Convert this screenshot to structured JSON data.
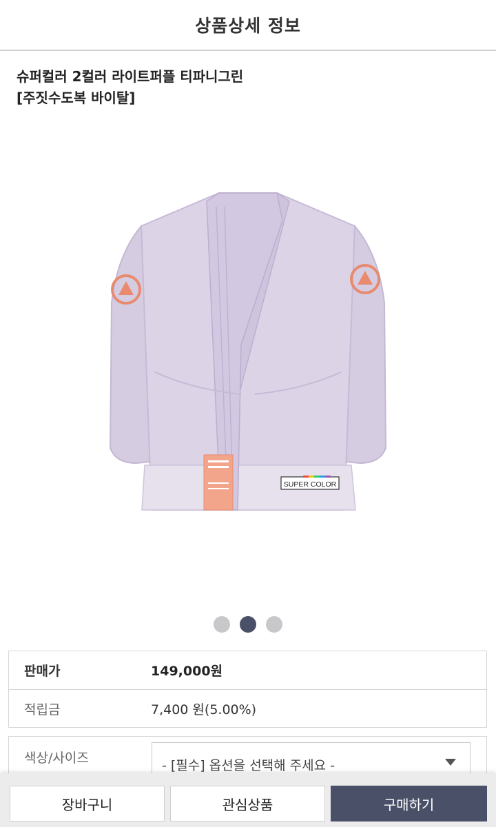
{
  "header": {
    "title": "상품상세 정보"
  },
  "product": {
    "name_line1": "슈퍼컬러 2컬러 라이트퍼플 티파니그린",
    "name_line2": "[주짓수도복 바이탈]",
    "image": {
      "patch_text": "SUPER COLOR",
      "belt_tag_text": "SUPER COLOR",
      "colors": {
        "gi": "#dcd3e6",
        "accent": "#e88a6e"
      }
    }
  },
  "carousel": {
    "count": 3,
    "active_index": 1
  },
  "info": {
    "price_label": "판매가",
    "price_value": "149,000원",
    "points_label": "적립금",
    "points_value": "7,400 원(5.00%)"
  },
  "option": {
    "label": "색상/사이즈",
    "placeholder": "- [필수] 옵션을 선택해 주세요 -"
  },
  "buttons": {
    "cart": "장바구니",
    "wishlist": "관심상품",
    "buy": "구매하기"
  },
  "colors": {
    "accent": "#4a5068",
    "dot_inactive": "#c8c8cb"
  }
}
